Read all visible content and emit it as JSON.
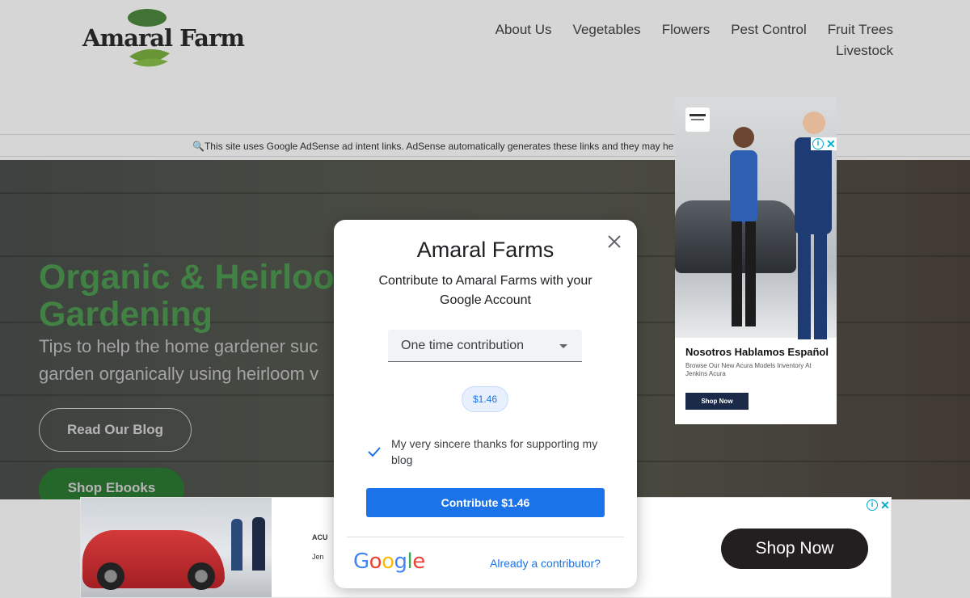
{
  "header": {
    "logo_text": "Amaral Farm",
    "nav": [
      "About Us",
      "Vegetables",
      "Flowers",
      "Pest Control",
      "Fruit Trees",
      "Livestock"
    ]
  },
  "notice": {
    "icon": "search-icon",
    "text": "This site uses Google AdSense ad intent links. AdSense automatically generates these links and they may he"
  },
  "hero": {
    "title_line1": "Organic & Heirloo",
    "title_line2": "Gardening",
    "subtitle_line1": "Tips to help the home gardener suc",
    "subtitle_line2": "garden organically using heirloom v",
    "blog_button": "Read Our Blog",
    "shop_button": "Shop Ebooks"
  },
  "side_ad": {
    "title": "Nosotros Hablamos Español",
    "body": "Browse Our New Acura Models Inventory At Jenkins Acura",
    "button": "Shop Now"
  },
  "bottom_ad": {
    "brand1": "ACU",
    "brand2": "Jen",
    "button": "Shop Now"
  },
  "modal": {
    "title": "Amaral Farms",
    "subtitle": "Contribute to Amaral Farms with your Google Account",
    "dropdown_value": "One time contribution",
    "amount": "$1.46",
    "thanks_message": "My very sincere thanks for supporting my blog",
    "contribute_button": "Contribute $1.46",
    "google_label": "Google",
    "already_link": "Already a contributor?"
  },
  "colors": {
    "hero_title": "#4f9a52",
    "primary_blue": "#1a73e8",
    "shop_button_green": "#2d7a34"
  }
}
